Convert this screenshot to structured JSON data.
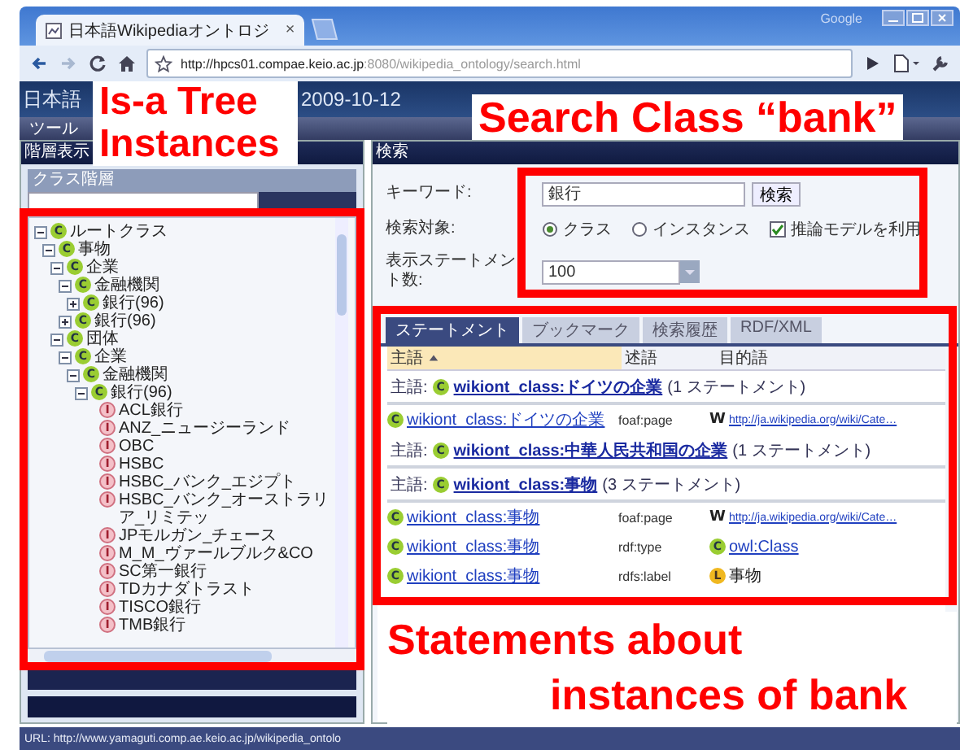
{
  "browser": {
    "brand": "Google",
    "tab_title": "日本語Wikipediaオントロジ",
    "tab_close": "×",
    "url_host": "http://hpcs01.compae.keio.ac.jp",
    "url_path": ":8080/wikipedia_ontology/search.html"
  },
  "app_header": {
    "title": "日本語",
    "date": "2009-10-12"
  },
  "menu": [
    "ツール"
  ],
  "left_panel": {
    "title": "階層表示",
    "tree_title": "クラス階層",
    "tree": [
      {
        "label": "ルートクラス",
        "icon": "C",
        "kind": "class",
        "expanded": true,
        "children": [
          {
            "label": "事物",
            "icon": "C",
            "kind": "class",
            "expanded": true,
            "children": [
              {
                "label": "企業",
                "icon": "C",
                "kind": "class",
                "expanded": true,
                "children": [
                  {
                    "label": "金融機関",
                    "icon": "C",
                    "kind": "class",
                    "expanded": true,
                    "children": [
                      {
                        "label": "銀行(96)",
                        "icon": "C",
                        "kind": "class",
                        "expanded": false
                      }
                    ]
                  },
                  {
                    "label": "銀行(96)",
                    "icon": "C",
                    "kind": "class",
                    "expanded": false
                  }
                ]
              },
              {
                "label": "団体",
                "icon": "C",
                "kind": "class",
                "expanded": true,
                "children": [
                  {
                    "label": "企業",
                    "icon": "C",
                    "kind": "class",
                    "expanded": true,
                    "children": [
                      {
                        "label": "金融機関",
                        "icon": "C",
                        "kind": "class",
                        "expanded": true,
                        "children": [
                          {
                            "label": "銀行(96)",
                            "icon": "C",
                            "kind": "class",
                            "expanded": true,
                            "children": [
                              {
                                "label": "ACL銀行",
                                "icon": "I",
                                "kind": "instance"
                              },
                              {
                                "label": "ANZ_ニュージーランド",
                                "icon": "I",
                                "kind": "instance"
                              },
                              {
                                "label": "OBC",
                                "icon": "I",
                                "kind": "instance"
                              },
                              {
                                "label": "HSBC",
                                "icon": "I",
                                "kind": "instance"
                              },
                              {
                                "label": "HSBC_バンク_エジプト",
                                "icon": "I",
                                "kind": "instance"
                              },
                              {
                                "label": "HSBC_バンク_オーストラリア_リミテッ",
                                "icon": "I",
                                "kind": "instance"
                              },
                              {
                                "label": "JPモルガン_チェース",
                                "icon": "I",
                                "kind": "instance"
                              },
                              {
                                "label": "M_M_ヴァールブルク&CO",
                                "icon": "I",
                                "kind": "instance"
                              },
                              {
                                "label": "SC第一銀行",
                                "icon": "I",
                                "kind": "instance"
                              },
                              {
                                "label": "TDカナダトラスト",
                                "icon": "I",
                                "kind": "instance"
                              },
                              {
                                "label": "TISCO銀行",
                                "icon": "I",
                                "kind": "instance"
                              },
                              {
                                "label": "TMB銀行",
                                "icon": "I",
                                "kind": "instance"
                              }
                            ]
                          }
                        ]
                      }
                    ]
                  }
                ]
              }
            ]
          }
        ]
      }
    ]
  },
  "search_panel": {
    "title": "検索",
    "keyword_label": "キーワード:",
    "keyword_value": "銀行",
    "search_button": "検索",
    "target_label": "検索対象:",
    "targets": [
      {
        "label": "クラス",
        "selected": true
      },
      {
        "label": "インスタンス",
        "selected": false
      }
    ],
    "inference": {
      "label": "推論モデルを利用",
      "checked": true
    },
    "count_label": "表示ステートメント数:",
    "count_value": "100"
  },
  "tabs": [
    {
      "label": "ステートメント",
      "selected": true
    },
    {
      "label": "ブックマーク",
      "selected": false
    },
    {
      "label": "検索履歴",
      "selected": false
    },
    {
      "label": "RDF/XML",
      "selected": false
    }
  ],
  "columns": [
    {
      "label": "主語",
      "sorted": true
    },
    {
      "label": "述語",
      "sorted": false
    },
    {
      "label": "目的語",
      "sorted": false
    }
  ],
  "rows": [
    {
      "kind": "group",
      "prefix": "主語:",
      "icon": "C",
      "subject": "wikiont_class:ドイツの企業",
      "count": "(1 ステートメント)"
    },
    {
      "kind": "statement",
      "icon": "C",
      "subject": "wikiont_class:ドイツの企業",
      "predicate": "foaf:page",
      "object": {
        "kind": "web",
        "icon": "W",
        "text": "http://ja.wikipedia.org/wiki/Cate…"
      }
    },
    {
      "kind": "group",
      "prefix": "主語:",
      "icon": "C",
      "subject": "wikiont_class:中華人民共和国の企業",
      "count": "(1 ステートメント)"
    },
    {
      "kind": "group",
      "prefix": "主語:",
      "icon": "C",
      "subject": "wikiont_class:事物",
      "count": "(3 ステートメント)"
    },
    {
      "kind": "statement",
      "icon": "C",
      "subject": "wikiont_class:事物",
      "predicate": "foaf:page",
      "object": {
        "kind": "web",
        "icon": "W",
        "text": "http://ja.wikipedia.org/wiki/Cate…"
      }
    },
    {
      "kind": "statement",
      "icon": "C",
      "subject": "wikiont_class:事物",
      "predicate": "rdf:type",
      "object": {
        "kind": "class",
        "icon": "C",
        "text": "owl:Class"
      }
    },
    {
      "kind": "statement",
      "icon": "C",
      "subject": "wikiont_class:事物",
      "predicate": "rdfs:label",
      "object": {
        "kind": "literal",
        "icon": "L",
        "text": "事物"
      }
    }
  ],
  "status_bar": "URL: http://www.yamaguti.comp.ae.keio.ac.jp/wikipedia_ontolo",
  "annotations": {
    "tree_label": "Is-a Tree\nInstances",
    "search_label": "Search Class “bank”",
    "statements_label": [
      "Statements about",
      "instances of bank"
    ]
  }
}
